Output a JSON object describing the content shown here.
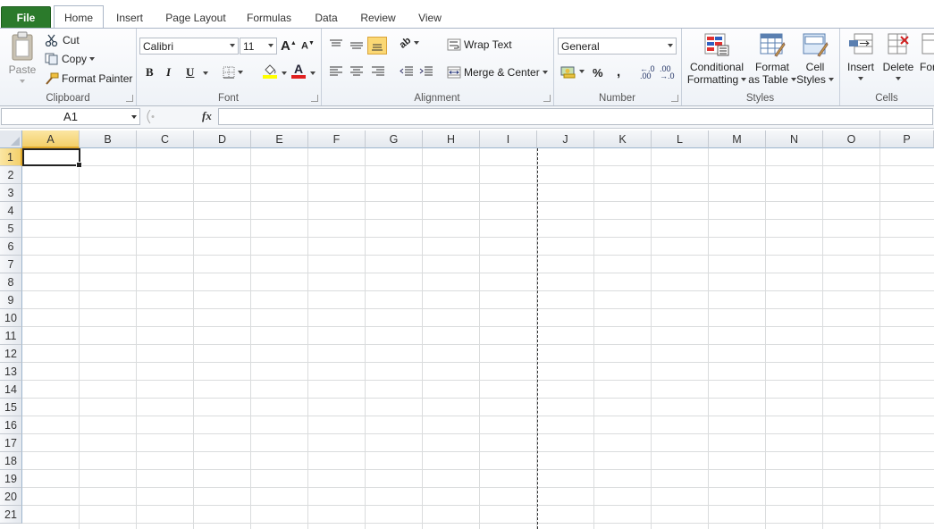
{
  "tabs": {
    "file": "File",
    "home": "Home",
    "insert": "Insert",
    "page_layout": "Page Layout",
    "formulas": "Formulas",
    "data": "Data",
    "review": "Review",
    "view": "View"
  },
  "clipboard": {
    "paste": "Paste",
    "cut": "Cut",
    "copy": "Copy",
    "format_painter": "Format Painter",
    "label": "Clipboard"
  },
  "font": {
    "name": "Calibri",
    "size": "11",
    "bold": "B",
    "italic": "I",
    "underline": "U",
    "label": "Font"
  },
  "alignment": {
    "wrap_text": "Wrap Text",
    "merge_center": "Merge & Center",
    "label": "Alignment"
  },
  "number": {
    "format": "General",
    "percent": "%",
    "comma": ",",
    "label": "Number"
  },
  "styles": {
    "conditional_1": "Conditional",
    "conditional_2": "Formatting",
    "format_table_1": "Format",
    "format_table_2": "as Table",
    "cell_styles_1": "Cell",
    "cell_styles_2": "Styles",
    "label": "Styles"
  },
  "cells": {
    "insert": "Insert",
    "delete": "Delete",
    "format": "For",
    "label": "Cells"
  },
  "formula_bar": {
    "name_box": "A1",
    "fx": "fx",
    "value": ""
  },
  "sheet": {
    "columns": [
      "A",
      "B",
      "C",
      "D",
      "E",
      "F",
      "G",
      "H",
      "I",
      "J",
      "K",
      "L",
      "M",
      "N",
      "O",
      "P"
    ],
    "rows": [
      "1",
      "2",
      "3",
      "4",
      "5",
      "6",
      "7",
      "8",
      "9",
      "10",
      "11",
      "12",
      "13",
      "14",
      "15",
      "16",
      "17",
      "18",
      "19",
      "20",
      "21"
    ],
    "active_cell": "A1"
  },
  "colors": {
    "file_tab": "#2b7a2b",
    "selected_header": "#f3cf6a",
    "gridline": "#dadcdd",
    "font_color_bar": "#e02020",
    "highlight_bar": "#ffff00"
  }
}
